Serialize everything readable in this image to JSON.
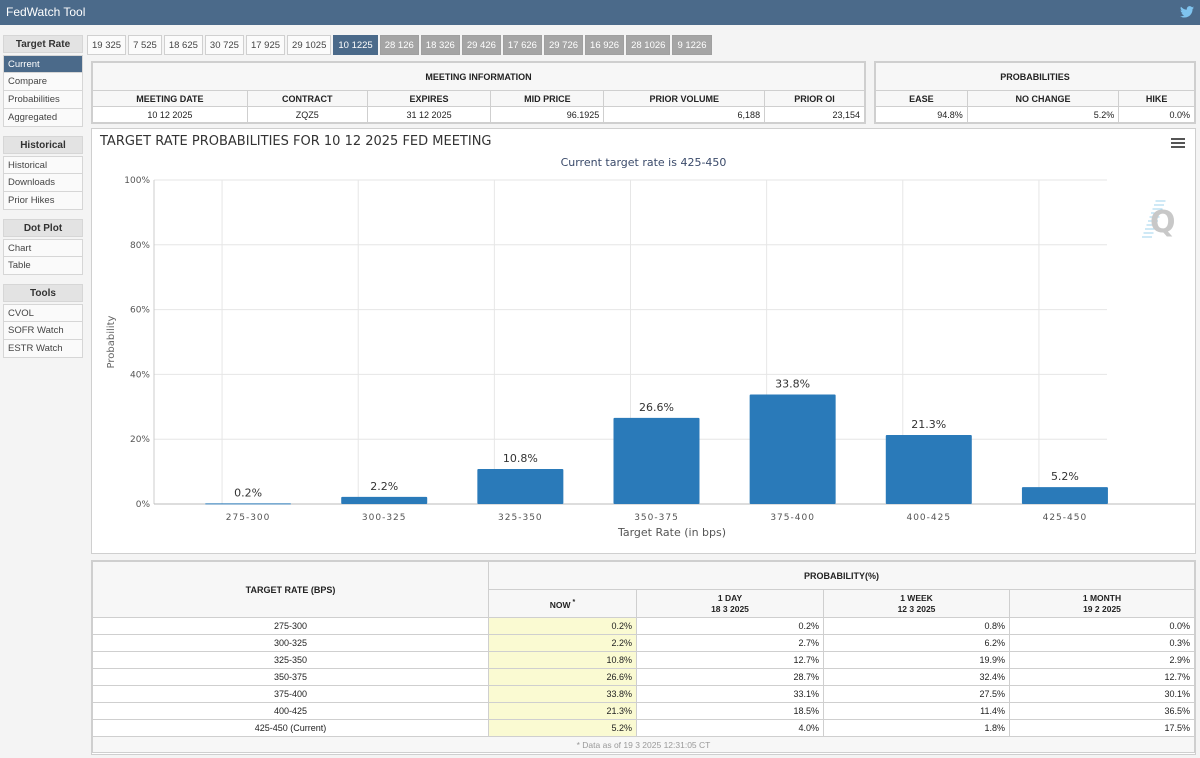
{
  "app": {
    "title": "FedWatch Tool",
    "social_icon": "twitter-icon"
  },
  "sidebar": {
    "sections": [
      {
        "label": "Target Rate",
        "items": [
          "Current",
          "Compare",
          "Probabilities",
          "Aggregated"
        ],
        "active": 0
      },
      {
        "label": "Historical",
        "items": [
          "Historical",
          "Downloads",
          "Prior Hikes"
        ]
      },
      {
        "label": "Dot Plot",
        "items": [
          "Chart",
          "Table"
        ]
      },
      {
        "label": "Tools",
        "items": [
          "CVOL",
          "SOFR Watch",
          "ESTR Watch"
        ]
      }
    ]
  },
  "meeting_tabs": {
    "items": [
      "19 325",
      "7 525",
      "18 625",
      "30 725",
      "17 925",
      "29 1025",
      "10 1225",
      "28 126",
      "18 326",
      "29 426",
      "17 626",
      "29 726",
      "16 926",
      "28 1026",
      "9 1226"
    ],
    "active_index": 6
  },
  "meeting_info": {
    "title": "MEETING INFORMATION",
    "columns": [
      "MEETING DATE",
      "CONTRACT",
      "EXPIRES",
      "MID PRICE",
      "PRIOR VOLUME",
      "PRIOR OI"
    ],
    "values": [
      "10 12 2025",
      "ZQZ5",
      "31 12 2025",
      "96.1925",
      "6,188",
      "23,154"
    ]
  },
  "probabilities": {
    "title": "PROBABILITIES",
    "columns": [
      "EASE",
      "NO CHANGE",
      "HIKE"
    ],
    "values": [
      "94.8%",
      "5.2%",
      "0.0%"
    ]
  },
  "chart_panel": {
    "menu_icon": "hamburger-menu-icon",
    "watermark": "Q"
  },
  "chart_data": {
    "type": "bar",
    "title": "TARGET RATE PROBABILITIES FOR 10 12 2025 FED MEETING",
    "subtitle": "Current target rate is 425-450",
    "xlabel": "Target Rate (in bps)",
    "ylabel": "Probability",
    "categories": [
      "275-300",
      "300-325",
      "325-350",
      "350-375",
      "375-400",
      "400-425",
      "425-450"
    ],
    "values": [
      0.2,
      2.2,
      10.8,
      26.6,
      33.8,
      21.3,
      5.2
    ],
    "data_labels": [
      "0.2%",
      "2.2%",
      "10.8%",
      "26.6%",
      "33.8%",
      "21.3%",
      "5.2%"
    ],
    "ylim": [
      0,
      100
    ],
    "yticks": [
      0,
      20,
      40,
      60,
      80,
      100
    ],
    "ytick_labels": [
      "0%",
      "20%",
      "40%",
      "60%",
      "80%",
      "100%"
    ],
    "grid": true,
    "bar_color": "#2a7ab9"
  },
  "prob_table": {
    "rate_header": "TARGET RATE (BPS)",
    "prob_header": "PROBABILITY(%)",
    "columns": [
      {
        "label": "NOW",
        "sub": "",
        "marker": "*"
      },
      {
        "label": "1 DAY",
        "sub": "18 3 2025"
      },
      {
        "label": "1 WEEK",
        "sub": "12 3 2025"
      },
      {
        "label": "1 MONTH",
        "sub": "19 2 2025"
      }
    ],
    "rows": [
      {
        "rate": "275-300",
        "vals": [
          "0.2%",
          "0.2%",
          "0.8%",
          "0.0%"
        ]
      },
      {
        "rate": "300-325",
        "vals": [
          "2.2%",
          "2.7%",
          "6.2%",
          "0.3%"
        ]
      },
      {
        "rate": "325-350",
        "vals": [
          "10.8%",
          "12.7%",
          "19.9%",
          "2.9%"
        ]
      },
      {
        "rate": "350-375",
        "vals": [
          "26.6%",
          "28.7%",
          "32.4%",
          "12.7%"
        ]
      },
      {
        "rate": "375-400",
        "vals": [
          "33.8%",
          "33.1%",
          "27.5%",
          "30.1%"
        ]
      },
      {
        "rate": "400-425",
        "vals": [
          "21.3%",
          "18.5%",
          "11.4%",
          "36.5%"
        ]
      },
      {
        "rate": "425-450 (Current)",
        "vals": [
          "5.2%",
          "4.0%",
          "1.8%",
          "17.5%"
        ]
      }
    ],
    "footnote": "* Data as of 19 3 2025 12:31:05 CT"
  }
}
